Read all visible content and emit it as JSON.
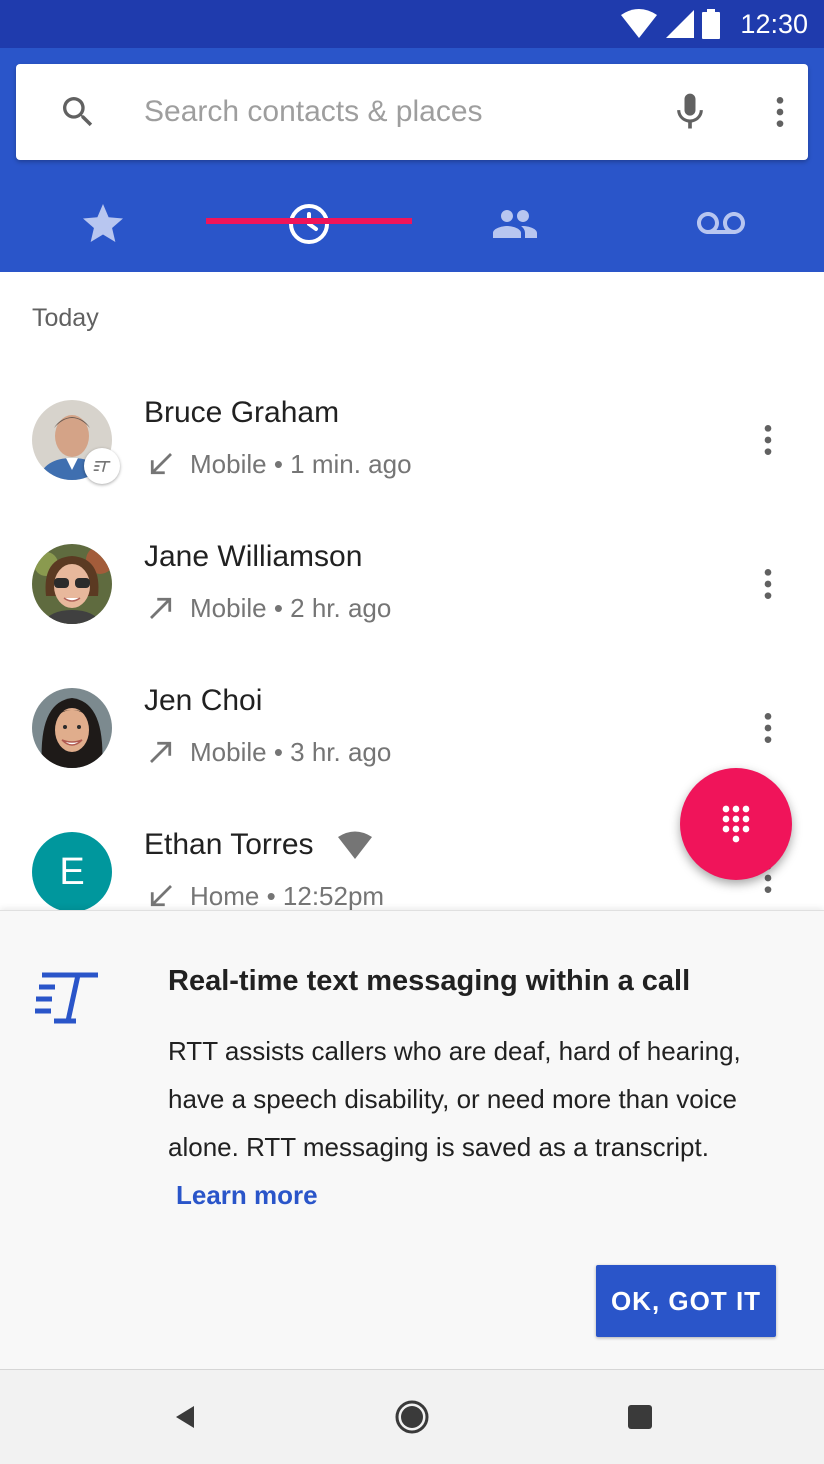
{
  "status_bar": {
    "time": "12:30"
  },
  "search": {
    "placeholder": "Search contacts & places"
  },
  "tabs": [
    {
      "name": "Favorites",
      "icon": "star-icon",
      "selected": false
    },
    {
      "name": "Recents",
      "icon": "clock-icon",
      "selected": true
    },
    {
      "name": "Contacts",
      "icon": "people-icon",
      "selected": false
    },
    {
      "name": "Voicemail",
      "icon": "voicemail-icon",
      "selected": false
    }
  ],
  "call_log": {
    "section_title": "Today",
    "calls": [
      {
        "name": "Bruce Graham",
        "direction": "incoming",
        "type": "Mobile",
        "time": "1 min. ago",
        "detail": "Mobile • 1 min. ago",
        "rtt": true
      },
      {
        "name": "Jane Williamson",
        "direction": "outgoing",
        "type": "Mobile",
        "time": "2 hr. ago",
        "detail": "Mobile • 2 hr. ago",
        "rtt": false
      },
      {
        "name": "Jen Choi",
        "direction": "outgoing",
        "type": "Mobile",
        "time": "3 hr. ago",
        "detail": "Mobile • 3 hr. ago",
        "rtt": false
      },
      {
        "name": "Ethan Torres",
        "initial": "E",
        "direction": "incoming",
        "type": "Home",
        "time": "12:52pm",
        "detail": "Home • 12:52pm",
        "wifi": true
      }
    ]
  },
  "promo": {
    "title": "Real-time text messaging within a call",
    "body": "RTT assists callers who are deaf, hard of hearing, have a speech disability, or need more than voice alone. RTT messaging is saved as a transcript.",
    "link": "Learn more",
    "button": "OK, GOT IT"
  },
  "colors": {
    "status_bar": "#1f3bad",
    "app_bar": "#2a55c9",
    "accent": "#f0145a",
    "letter_avatar": "#00979d"
  }
}
